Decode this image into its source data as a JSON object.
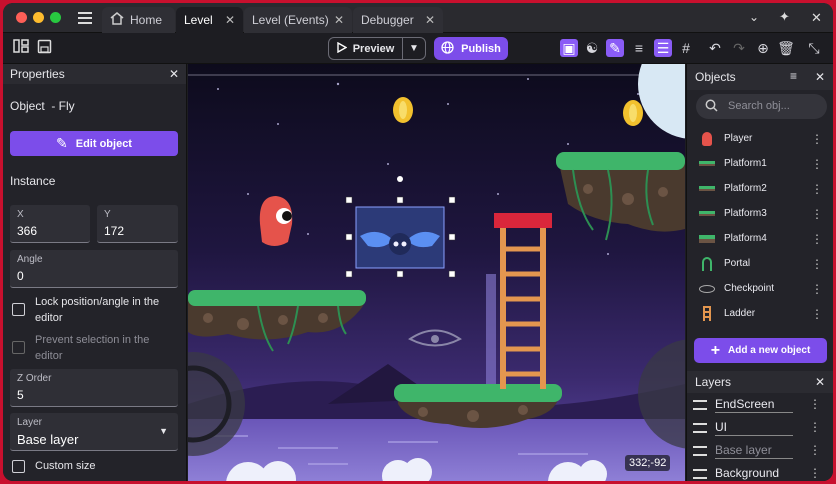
{
  "tabs": [
    {
      "label": "Home"
    },
    {
      "label": "Level"
    },
    {
      "label": "Level (Events)"
    },
    {
      "label": "Debugger"
    }
  ],
  "toolbar": {
    "preview_label": "Preview",
    "publish_label": "Publish"
  },
  "properties": {
    "title": "Properties",
    "object_label": "Object  - Fly",
    "edit_object_label": "Edit object",
    "instance_label": "Instance",
    "x_label": "X",
    "x_value": "366",
    "y_label": "Y",
    "y_value": "172",
    "angle_label": "Angle",
    "angle_value": "0",
    "lock_label": "Lock position/angle in the editor",
    "prevent_label": "Prevent selection in the editor",
    "zorder_label": "Z Order",
    "zorder_value": "5",
    "layer_label": "Layer",
    "layer_value": "Base layer",
    "custom_size_label": "Custom size"
  },
  "scene": {
    "cursor_coords": "332;-92"
  },
  "objects": {
    "title": "Objects",
    "search_placeholder": "Search obj...",
    "items": [
      {
        "label": "Player",
        "icon": "player-icon"
      },
      {
        "label": "Platform1",
        "icon": "platform-icon"
      },
      {
        "label": "Platform2",
        "icon": "platform-icon"
      },
      {
        "label": "Platform3",
        "icon": "platform-icon"
      },
      {
        "label": "Platform4",
        "icon": "platform-icon"
      },
      {
        "label": "Portal",
        "icon": "portal-icon"
      },
      {
        "label": "Checkpoint",
        "icon": "checkpoint-icon"
      },
      {
        "label": "Ladder",
        "icon": "ladder-icon"
      }
    ],
    "add_label": "Add a new object"
  },
  "layers": {
    "title": "Layers",
    "items": [
      {
        "label": "EndScreen"
      },
      {
        "label": "UI"
      },
      {
        "label": "Base layer"
      },
      {
        "label": "Background"
      }
    ]
  },
  "colors": {
    "accent": "#7c4dea",
    "frame": "#c8102e"
  }
}
